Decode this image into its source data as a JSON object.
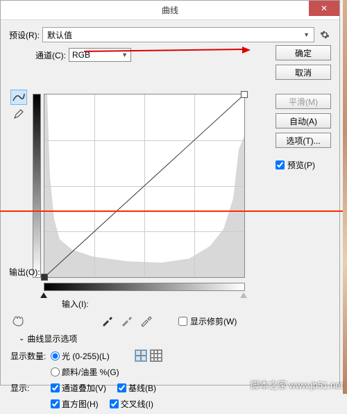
{
  "titlebar": {
    "title": "曲线",
    "close": "✕"
  },
  "preset": {
    "label": "预设(R):",
    "value": "默认值",
    "gear_icon": "gear"
  },
  "buttons": {
    "ok": "确定",
    "cancel": "取消",
    "smooth": "平滑(M)",
    "auto": "自动(A)",
    "options": "选项(T)..."
  },
  "preview": {
    "label": "预览(P)",
    "checked": true
  },
  "channel": {
    "label": "通道(C):",
    "value": "RGB"
  },
  "output": {
    "label": "输出(O):"
  },
  "input": {
    "label": "输入(I):"
  },
  "show_clip": {
    "label": "显示修剪(W)"
  },
  "expander": {
    "label": "曲线显示选项"
  },
  "amount": {
    "label": "显示数量:",
    "light": "光 (0-255)(L)",
    "pigment": "颜料/油墨 %(G)"
  },
  "show": {
    "label": "显示:",
    "overlay": "通道叠加(V)",
    "baseline": "基线(B)",
    "histogram": "直方图(H)",
    "intersection": "交叉线(I)"
  },
  "watermark": "脚本之家 www.jb51.net"
}
